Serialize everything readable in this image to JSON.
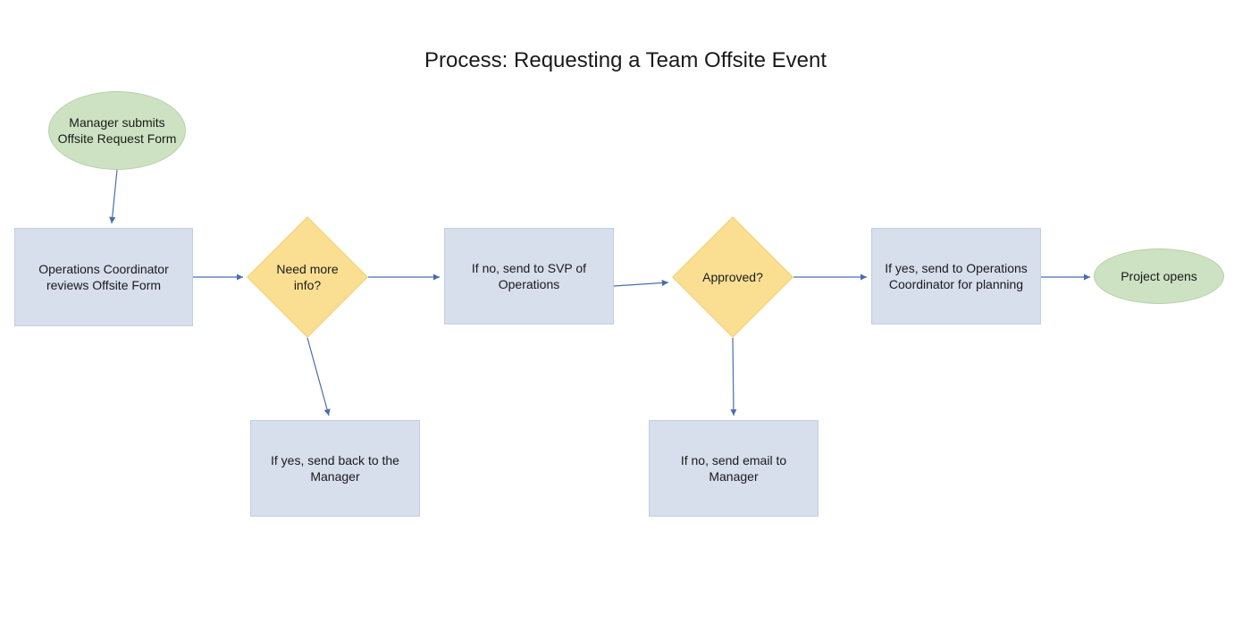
{
  "title": "Process: Requesting a Team Offsite Event",
  "nodes": {
    "start": "Manager submits Offsite Request Form",
    "review": "Operations Coordinator reviews Offsite Form",
    "need_info": "Need more info?",
    "yes_back": "If yes, send back to the Manager",
    "no_svp": "If no, send to SVP of Operations",
    "approved": "Approved?",
    "no_email": "If no, send email to Manager",
    "yes_plan": "If yes, send to Operations Coordinator for planning",
    "end": "Project opens"
  },
  "colors": {
    "bg": "#ffffff",
    "ellipse_fill": "#cde2c2",
    "ellipse_stroke": "#b7d1a8",
    "rect_fill": "#d7deec",
    "rect_stroke": "#c3cee2",
    "diamond_fill": "#fadf93",
    "diamond_stroke": "#f0d06f",
    "arrow": "#4a6ea9"
  }
}
